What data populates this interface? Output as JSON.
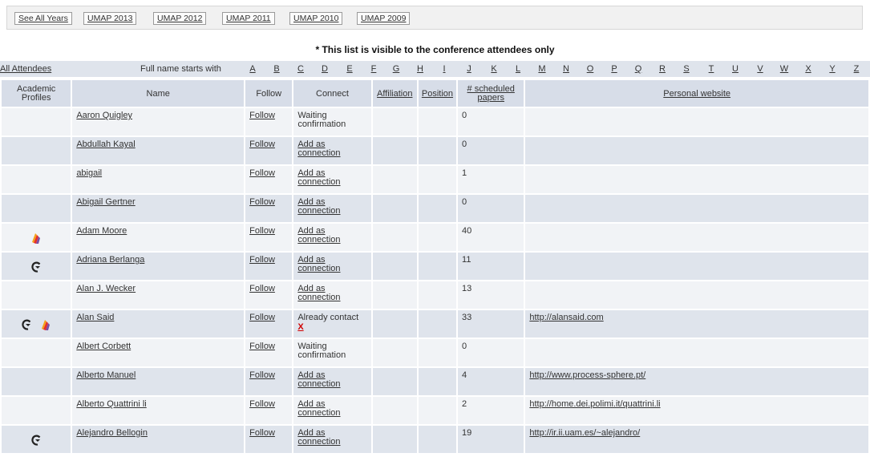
{
  "years": [
    {
      "label": "See All Years"
    },
    {
      "label": "UMAP 2013"
    },
    {
      "label": "UMAP 2012"
    },
    {
      "label": "UMAP 2011"
    },
    {
      "label": "UMAP 2010"
    },
    {
      "label": "UMAP 2009"
    }
  ],
  "notice": "* This list is visible to the conference attendees only",
  "filter": {
    "all_label": "All Attendees",
    "starts_label": "Full name starts with",
    "letters": [
      "A",
      "B",
      "C",
      "D",
      "E",
      "F",
      "G",
      "H",
      "I",
      "J",
      "K",
      "L",
      "M",
      "N",
      "O",
      "P",
      "Q",
      "R",
      "S",
      "T",
      "U",
      "V",
      "W",
      "X",
      "Y",
      "Z"
    ]
  },
  "columns": {
    "profiles": "Academic Profiles",
    "name": "Name",
    "follow": "Follow",
    "connect": "Connect",
    "affiliation": "Affiliation",
    "position": "Position",
    "papers": "# scheduled papers",
    "website": "Personal website"
  },
  "rows": [
    {
      "name": "Aaron Quigley",
      "follow": "Follow",
      "connect": "Waiting confirmation",
      "connect_link": false,
      "remove": "",
      "papers": "0",
      "website": "",
      "icons": []
    },
    {
      "name": "Abdullah Kayal",
      "follow": "Follow",
      "connect": "Add as connection",
      "connect_link": true,
      "remove": "",
      "papers": "0",
      "website": "",
      "icons": []
    },
    {
      "name": "abigail",
      "follow": "Follow",
      "connect": "Add as connection",
      "connect_link": true,
      "remove": "",
      "papers": "1",
      "website": "",
      "icons": []
    },
    {
      "name": "Abigail Gertner",
      "follow": "Follow",
      "connect": "Add as connection",
      "connect_link": true,
      "remove": "",
      "papers": "0",
      "website": "",
      "icons": []
    },
    {
      "name": "Adam Moore",
      "follow": "Follow",
      "connect": "Add as connection",
      "connect_link": true,
      "remove": "",
      "papers": "40",
      "website": "",
      "icons": [
        "mendeley-icon"
      ]
    },
    {
      "name": "Adriana Berlanga",
      "follow": "Follow",
      "connect": "Add as connection",
      "connect_link": true,
      "remove": "",
      "papers": "11",
      "website": "",
      "icons": [
        "citeulike-icon"
      ]
    },
    {
      "name": "Alan J. Wecker",
      "follow": "Follow",
      "connect": "Add as connection",
      "connect_link": true,
      "remove": "",
      "papers": "13",
      "website": "",
      "icons": []
    },
    {
      "name": "Alan Said",
      "follow": "Follow",
      "connect": "Already contact",
      "connect_link": false,
      "remove": "X",
      "papers": "33",
      "website": "http://alansaid.com",
      "icons": [
        "citeulike-icon",
        "mendeley-icon"
      ]
    },
    {
      "name": "Albert Corbett",
      "follow": "Follow",
      "connect": "Waiting confirmation",
      "connect_link": false,
      "remove": "",
      "papers": "0",
      "website": "",
      "icons": []
    },
    {
      "name": "Alberto Manuel",
      "follow": "Follow",
      "connect": "Add as connection",
      "connect_link": true,
      "remove": "",
      "papers": "4",
      "website": "http://www.process-sphere.pt/",
      "icons": []
    },
    {
      "name": "Alberto Quattrini li",
      "follow": "Follow",
      "connect": "Add as connection",
      "connect_link": true,
      "remove": "",
      "papers": "2",
      "website": "http://home.dei.polimi.it/quattrini.li",
      "icons": []
    },
    {
      "name": "Alejandro Bellogin",
      "follow": "Follow",
      "connect": "Add as connection",
      "connect_link": true,
      "remove": "",
      "papers": "19",
      "website": "http://ir.ii.uam.es/~alejandro/",
      "icons": [
        "citeulike-icon"
      ]
    }
  ],
  "colors": {
    "header_bg": "#d7dde8",
    "row_light": "#f1f3f6",
    "row_dark": "#dfe4ec",
    "remove_red": "#d00000"
  }
}
